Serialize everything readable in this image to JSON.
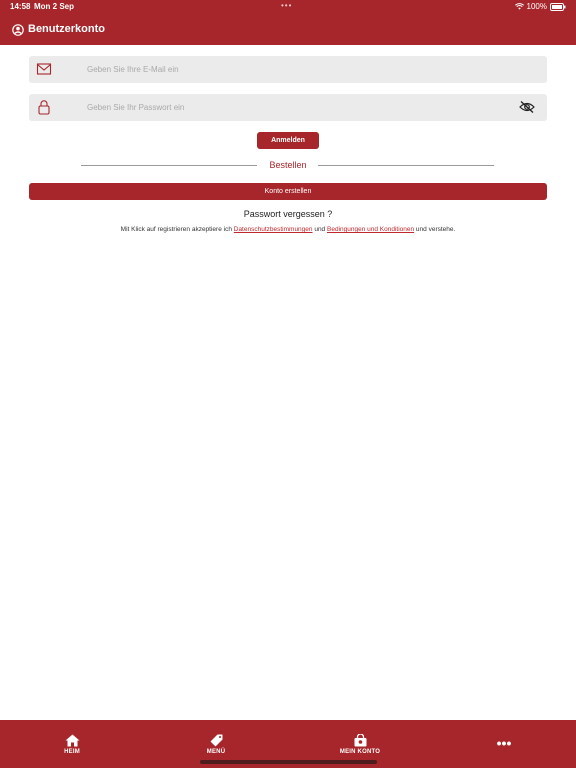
{
  "status_bar": {
    "time": "14:58",
    "date": "Mon 2 Sep",
    "dots": "•••",
    "battery": "100%"
  },
  "header": {
    "title": "Benutzerkonto",
    "icon": "user-circle-icon"
  },
  "login_form": {
    "email_placeholder": "Geben Sie Ihre E-Mail ein",
    "email_value": "",
    "password_placeholder": "Geben Sie Ihr Passwort ein",
    "password_value": "",
    "login_label": "Anmelden",
    "divider_label": "Bestellen",
    "create_account_label": "Konto erstellen",
    "forgot_password": "Passwort vergessen ?"
  },
  "terms": {
    "prefix": "Mit Klick auf registrieren akzeptiere ich",
    "privacy_link": "Datenschutzbestimmungen",
    "conjunction": "und",
    "conditions_link": "Bedingungen und Konditionen",
    "suffix": "und verstehe."
  },
  "tab_bar": {
    "items": [
      {
        "label": "HEIM",
        "icon": "home-icon"
      },
      {
        "label": "MENÜ",
        "icon": "tag-icon"
      },
      {
        "label": "MEIN KONTO",
        "icon": "shopping-bag-icon"
      },
      {
        "label": "•••",
        "icon": "more-icon"
      }
    ]
  },
  "colors": {
    "brand": "#a6262b",
    "field_bg": "#ebebeb",
    "link": "#c0282d"
  }
}
